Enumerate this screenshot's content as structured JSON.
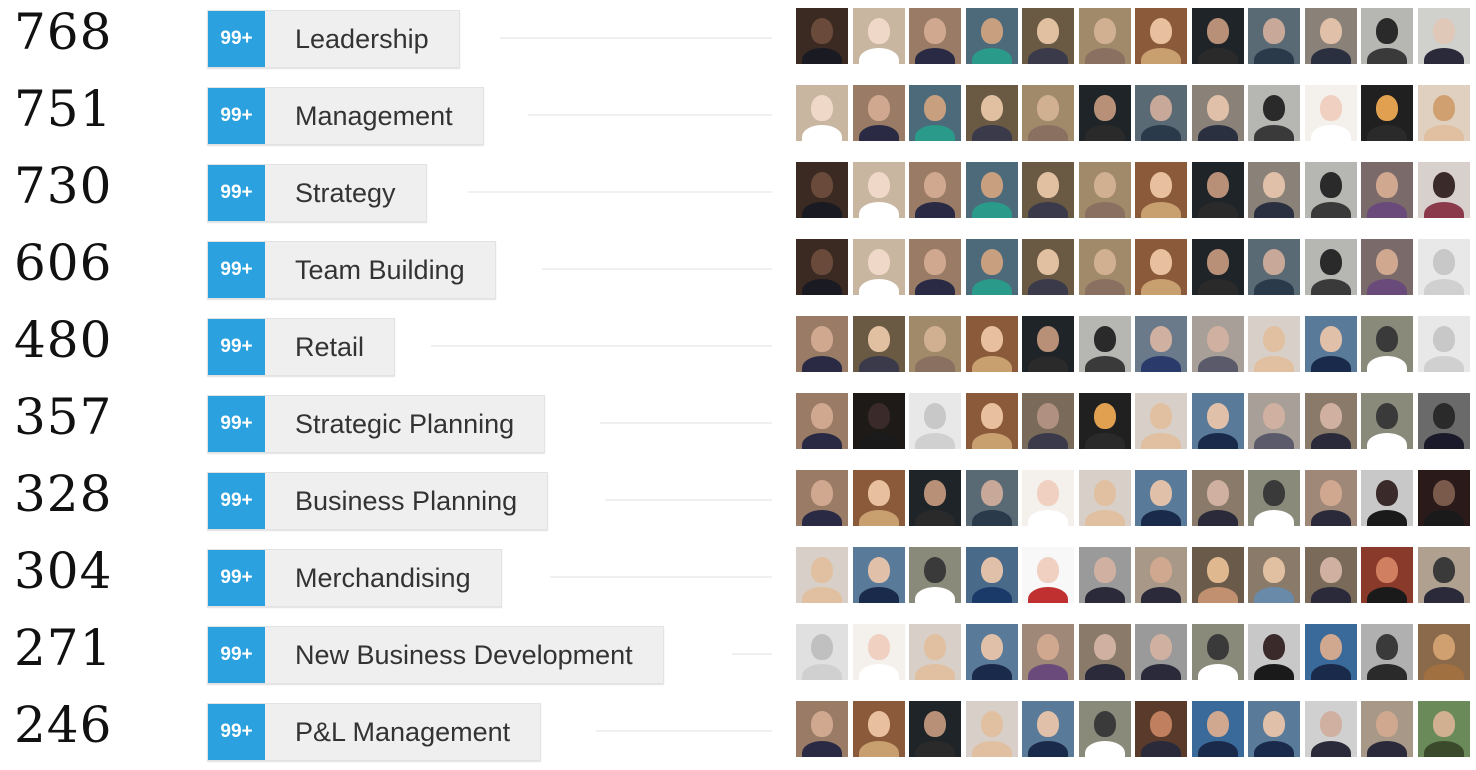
{
  "rows": [
    {
      "count": "768",
      "badge": "99+",
      "skill": "Leadership",
      "bg": [
        "#3a2a22",
        "#c9b6a0",
        "#9a7c66",
        "#4d6a7a",
        "#6a5a44",
        "#a08a6a",
        "#8a5a3a",
        "#1e2428",
        "#5a6a74",
        "#8a8278",
        "#b6b6b2",
        "#d0d0cc"
      ],
      "fg": [
        "#6a4a3a",
        "#f0d8c8",
        "#d0a890",
        "#c8a080",
        "#e0c0a0",
        "#d0b090",
        "#e8c0a0",
        "#b89078",
        "#c8a898",
        "#e0c0a8",
        "#2a2a2a",
        "#e0c8b8"
      ],
      "cl": [
        "#1a1a22",
        "#ffffff",
        "#2a2a44",
        "#2a9a8a",
        "#3a3a4a",
        "#8a7060",
        "#c8a070",
        "#2a2a2a",
        "#2a3a4a",
        "#2a3040",
        "#3a3a3a",
        "#2a2a3a"
      ]
    },
    {
      "count": "751",
      "badge": "99+",
      "skill": "Management",
      "bg": [
        "#c9b6a0",
        "#9a7c66",
        "#4d6a7a",
        "#6a5a44",
        "#a08a6a",
        "#1e2428",
        "#5a6a74",
        "#8a8278",
        "#b6b6b2",
        "#f4f0ec",
        "#202020",
        "#e0d0c0"
      ],
      "fg": [
        "#f0d8c8",
        "#d0a890",
        "#c8a080",
        "#e0c0a0",
        "#d0b090",
        "#b89078",
        "#c8a898",
        "#e0c0a8",
        "#2a2a2a",
        "#f0d0c0",
        "#e0a050",
        "#d0a070"
      ],
      "cl": [
        "#ffffff",
        "#2a2a44",
        "#2a9a8a",
        "#3a3a4a",
        "#8a7060",
        "#2a2a2a",
        "#2a3a4a",
        "#2a3040",
        "#3a3a3a",
        "#ffffff",
        "#2a2a2a",
        "#e0c0a0"
      ]
    },
    {
      "count": "730",
      "badge": "99+",
      "skill": "Strategy",
      "bg": [
        "#3a2a22",
        "#c9b6a0",
        "#9a7c66",
        "#4d6a7a",
        "#6a5a44",
        "#a08a6a",
        "#8a5a3a",
        "#1e2428",
        "#8a8278",
        "#b6b6b2",
        "#7a6a6a",
        "#d8d0cc"
      ],
      "fg": [
        "#6a4a3a",
        "#f0d8c8",
        "#d0a890",
        "#c8a080",
        "#e0c0a0",
        "#d0b090",
        "#e8c0a0",
        "#b89078",
        "#e0c0a8",
        "#2a2a2a",
        "#d0a890",
        "#3a2a2a"
      ],
      "cl": [
        "#1a1a22",
        "#ffffff",
        "#2a2a44",
        "#2a9a8a",
        "#3a3a4a",
        "#8a7060",
        "#c8a070",
        "#2a2a2a",
        "#2a3040",
        "#3a3a3a",
        "#6a4a7a",
        "#8a3a4a"
      ]
    },
    {
      "count": "606",
      "badge": "99+",
      "skill": "Team Building",
      "bg": [
        "#3a2a22",
        "#c9b6a0",
        "#9a7c66",
        "#4d6a7a",
        "#6a5a44",
        "#a08a6a",
        "#8a5a3a",
        "#1e2428",
        "#5a6a74",
        "#b6b6b2",
        "#7a6a6a",
        "#e8e8e8"
      ],
      "fg": [
        "#6a4a3a",
        "#f0d8c8",
        "#d0a890",
        "#c8a080",
        "#e0c0a0",
        "#d0b090",
        "#e8c0a0",
        "#b89078",
        "#c8a898",
        "#2a2a2a",
        "#d0a890",
        "#c8c8c8"
      ],
      "cl": [
        "#1a1a22",
        "#ffffff",
        "#2a2a44",
        "#2a9a8a",
        "#3a3a4a",
        "#8a7060",
        "#c8a070",
        "#2a2a2a",
        "#2a3a4a",
        "#3a3a3a",
        "#6a4a7a",
        "#d0d0d0"
      ]
    },
    {
      "count": "480",
      "badge": "99+",
      "skill": "Retail",
      "bg": [
        "#9a7c66",
        "#6a5a44",
        "#a08a6a",
        "#8a5a3a",
        "#1e2428",
        "#b6b6b2",
        "#6a7a8a",
        "#a8a098",
        "#d8d0c8",
        "#5a7a9a",
        "#8a8a7a",
        "#e8e8e8"
      ],
      "fg": [
        "#d0a890",
        "#e0c0a0",
        "#d0b090",
        "#e8c0a0",
        "#b89078",
        "#2a2a2a",
        "#d0b0a0",
        "#d0b0a0",
        "#e0c0a0",
        "#e0c0a8",
        "#3a3a3a",
        "#c8c8c8"
      ],
      "cl": [
        "#2a2a44",
        "#3a3a4a",
        "#8a7060",
        "#c8a070",
        "#2a2a2a",
        "#3a3a3a",
        "#2a3a6a",
        "#5a5a6a",
        "#e0c0a0",
        "#1a2a4a",
        "#ffffff",
        "#d0d0d0"
      ]
    },
    {
      "count": "357",
      "badge": "99+",
      "skill": "Strategic Planning",
      "bg": [
        "#9a7c66",
        "#1e1a18",
        "#e8e8e8",
        "#8a5a3a",
        "#7a6a5a",
        "#202020",
        "#d8d0c8",
        "#5a7a9a",
        "#a8a098",
        "#8a7a6a",
        "#8a8a7a",
        "#6a6a6a"
      ],
      "fg": [
        "#d0a890",
        "#3a2a2a",
        "#c8c8c8",
        "#e8c0a0",
        "#b09080",
        "#e0a050",
        "#e0c0a0",
        "#e0c0a8",
        "#d0b0a0",
        "#d0b0a0",
        "#3a3a3a",
        "#2a2a2a"
      ],
      "cl": [
        "#2a2a44",
        "#1a1a1a",
        "#d0d0d0",
        "#c8a070",
        "#3a3a4a",
        "#2a2a2a",
        "#e0c0a0",
        "#1a2a4a",
        "#5a5a6a",
        "#2a2a3a",
        "#ffffff",
        "#1a1a2a"
      ]
    },
    {
      "count": "328",
      "badge": "99+",
      "skill": "Business Planning",
      "bg": [
        "#9a7c66",
        "#8a5a3a",
        "#1e2428",
        "#5a6a74",
        "#f4f0ec",
        "#d8d0c8",
        "#5a7a9a",
        "#8a7a6a",
        "#8a8a7a",
        "#a08878",
        "#c8c8c8",
        "#2a1a1a"
      ],
      "fg": [
        "#d0a890",
        "#e8c0a0",
        "#b89078",
        "#c8a898",
        "#f0d0c0",
        "#e0c0a0",
        "#e0c0a8",
        "#d0b0a0",
        "#3a3a3a",
        "#d0a890",
        "#3a2a2a",
        "#7a5a4a"
      ],
      "cl": [
        "#2a2a44",
        "#c8a070",
        "#2a2a2a",
        "#2a3a4a",
        "#ffffff",
        "#e0c0a0",
        "#1a2a4a",
        "#2a2a3a",
        "#ffffff",
        "#2a2a3a",
        "#1a1a1a",
        "#1a1a1a"
      ]
    },
    {
      "count": "304",
      "badge": "99+",
      "skill": "Merchandising",
      "bg": [
        "#d8d0c8",
        "#5a7a9a",
        "#8a8a7a",
        "#4a6a8a",
        "#f8f8f8",
        "#9a9a9a",
        "#a89888",
        "#6a5a4a",
        "#8a7a6a",
        "#7a6a5a",
        "#8a3a2a",
        "#b0a090"
      ],
      "fg": [
        "#e0c0a0",
        "#e0c0a8",
        "#3a3a3a",
        "#e0c0a8",
        "#f0d0c0",
        "#d0b0a0",
        "#d0a890",
        "#e0b890",
        "#e0c0a0",
        "#d0b0a0",
        "#d08060",
        "#3a3a3a"
      ],
      "cl": [
        "#e0c0a0",
        "#1a2a4a",
        "#ffffff",
        "#1a3a6a",
        "#c03030",
        "#2a2a3a",
        "#2a2a3a",
        "#c09070",
        "#6a8aaa",
        "#2a2a3a",
        "#1a1a1a",
        "#2a2a3a"
      ]
    },
    {
      "count": "271",
      "badge": "99+",
      "skill": "New Business Development",
      "bg": [
        "#e0e0e0",
        "#f4f0ec",
        "#d8d0c8",
        "#5a7a9a",
        "#a08878",
        "#8a7a6a",
        "#9a9a9a",
        "#8a8a7a",
        "#c8c8c8",
        "#3a6a9a",
        "#b0b0b0",
        "#8a6a4a"
      ],
      "fg": [
        "#c0c0c0",
        "#f0d0c0",
        "#e0c0a0",
        "#e0c0a8",
        "#d0a890",
        "#d0b0a0",
        "#d0b0a0",
        "#3a3a3a",
        "#3a2a2a",
        "#d0a890",
        "#3a3a3a",
        "#d0a070"
      ],
      "cl": [
        "#d0d0d0",
        "#ffffff",
        "#e0c0a0",
        "#1a2a4a",
        "#6a4a7a",
        "#2a2a3a",
        "#2a2a3a",
        "#ffffff",
        "#1a1a1a",
        "#1a2a4a",
        "#2a2a2a",
        "#a07040"
      ]
    },
    {
      "count": "246",
      "badge": "99+",
      "skill": "P&L Management",
      "bg": [
        "#9a7c66",
        "#8a5a3a",
        "#1e2428",
        "#d8d0c8",
        "#5a7a9a",
        "#8a8a7a",
        "#5a3a2a",
        "#3a6a9a",
        "#5a7a9a",
        "#d0d0d0",
        "#a89888",
        "#6a8a5a"
      ],
      "fg": [
        "#d0a890",
        "#e8c0a0",
        "#b89078",
        "#e0c0a0",
        "#e0c0a8",
        "#3a3a3a",
        "#c08060",
        "#d0a890",
        "#e0c0a8",
        "#d0b0a0",
        "#d0a890",
        "#d0b090"
      ],
      "cl": [
        "#2a2a44",
        "#c8a070",
        "#2a2a2a",
        "#e0c0a0",
        "#1a2a4a",
        "#ffffff",
        "#2a2a3a",
        "#1a2a4a",
        "#1a2a4a",
        "#2a2a3a",
        "#2a2a3a",
        "#3a4a2a"
      ]
    }
  ]
}
